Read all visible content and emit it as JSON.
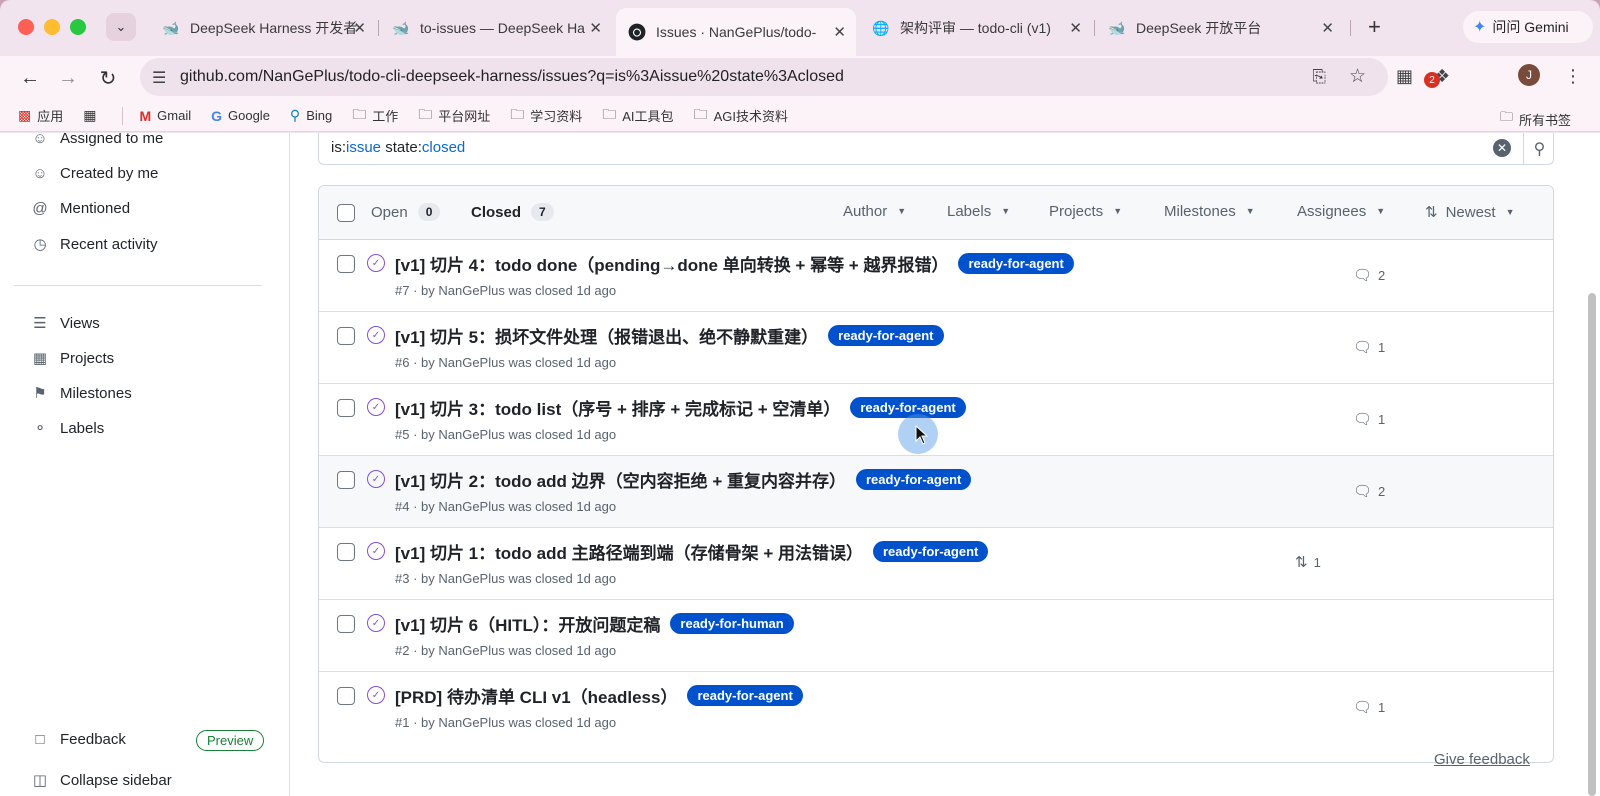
{
  "browser": {
    "tabs": [
      {
        "title": "DeepSeek Harness 开发者",
        "favicon": "deepseek-icon",
        "active": false
      },
      {
        "title": "to-issues — DeepSeek Ha",
        "favicon": "deepseek-icon",
        "active": false
      },
      {
        "title": "Issues · NanGePlus/todo-",
        "favicon": "github-icon",
        "active": true
      },
      {
        "title": "架构评审 — todo-cli (v1)",
        "favicon": "globe-icon",
        "active": false
      },
      {
        "title": "DeepSeek 开放平台",
        "favicon": "deepseek-icon",
        "active": false
      }
    ],
    "gemini_label": "问问 Gemini",
    "url": "github.com/NanGePlus/todo-cli-deepseek-harness/issues?q=is%3Aissue%20state%3Aclosed",
    "extension_badge": "2",
    "avatar_letter": "J",
    "bookmarks": [
      {
        "label": "应用",
        "icon": "apps-grid-icon"
      },
      {
        "label": "Gmail",
        "icon": "gmail-icon"
      },
      {
        "label": "Google",
        "icon": "google-icon"
      },
      {
        "label": "Bing",
        "icon": "bing-icon"
      },
      {
        "label": "工作",
        "icon": "folder-icon"
      },
      {
        "label": "平台网址",
        "icon": "folder-icon"
      },
      {
        "label": "学习资料",
        "icon": "folder-icon"
      },
      {
        "label": "AI工具包",
        "icon": "folder-icon"
      },
      {
        "label": "AGI技术资料",
        "icon": "folder-icon"
      }
    ],
    "all_bookmarks_label": "所有书签"
  },
  "sidebar": {
    "items_top": [
      {
        "label": "Assigned to me",
        "icon": "person-icon"
      },
      {
        "label": "Created by me",
        "icon": "smiley-icon"
      },
      {
        "label": "Mentioned",
        "icon": "mention-icon"
      },
      {
        "label": "Recent activity",
        "icon": "clock-icon"
      }
    ],
    "items_bottom": [
      {
        "label": "Views",
        "icon": "stack-icon"
      },
      {
        "label": "Projects",
        "icon": "table-icon"
      },
      {
        "label": "Milestones",
        "icon": "milestone-icon"
      },
      {
        "label": "Labels",
        "icon": "tag-icon"
      }
    ],
    "feedback_label": "Feedback",
    "preview_badge": "Preview",
    "collapse_label": "Collapse sidebar"
  },
  "search": {
    "query_prefix": "is:",
    "query_is_value": "issue",
    "query_state_key": " state:",
    "query_state_value": "closed"
  },
  "issues_header": {
    "open_label": "Open",
    "open_count": "0",
    "closed_label": "Closed",
    "closed_count": "7",
    "filters": [
      "Author",
      "Labels",
      "Projects",
      "Milestones",
      "Assignees"
    ],
    "sort_label": "Newest"
  },
  "issues": [
    {
      "title": "[v1] 切片 4：todo done（pending→done 单向转换 + 幂等 + 越界报错）",
      "label": "ready-for-agent",
      "meta": "#7 · by NanGePlus was closed 1d ago",
      "comments": "2",
      "linked_pr": ""
    },
    {
      "title": "[v1] 切片 5：损坏文件处理（报错退出、绝不静默重建）",
      "label": "ready-for-agent",
      "meta": "#6 · by NanGePlus was closed 1d ago",
      "comments": "1",
      "linked_pr": ""
    },
    {
      "title": "[v1] 切片 3：todo list（序号 + 排序 + 完成标记 + 空清单）",
      "label": "ready-for-agent",
      "meta": "#5 · by NanGePlus was closed 1d ago",
      "comments": "1",
      "linked_pr": ""
    },
    {
      "title": "[v1] 切片 2：todo add 边界（空内容拒绝 + 重复内容并存）",
      "label": "ready-for-agent",
      "meta": "#4 · by NanGePlus was closed 1d ago",
      "comments": "2",
      "linked_pr": ""
    },
    {
      "title": "[v1] 切片 1：todo add 主路径端到端（存储骨架 + 用法错误）",
      "label": "ready-for-agent",
      "meta": "#3 · by NanGePlus was closed 1d ago",
      "comments": "",
      "linked_pr": "1"
    },
    {
      "title": "[v1] 切片 6（HITL）：开放问题定稿",
      "label": "ready-for-human",
      "meta": "#2 · by NanGePlus was closed 1d ago",
      "comments": "",
      "linked_pr": ""
    },
    {
      "title": "[PRD] 待办清单 CLI v1（headless）",
      "label": "ready-for-agent",
      "meta": "#1 · by NanGePlus was closed 1d ago",
      "comments": "1",
      "linked_pr": ""
    }
  ],
  "give_feedback_label": "Give feedback",
  "colors": {
    "label_bg": "#0052cc",
    "closed_icon": "#8250df",
    "link_blue": "#0969da"
  }
}
